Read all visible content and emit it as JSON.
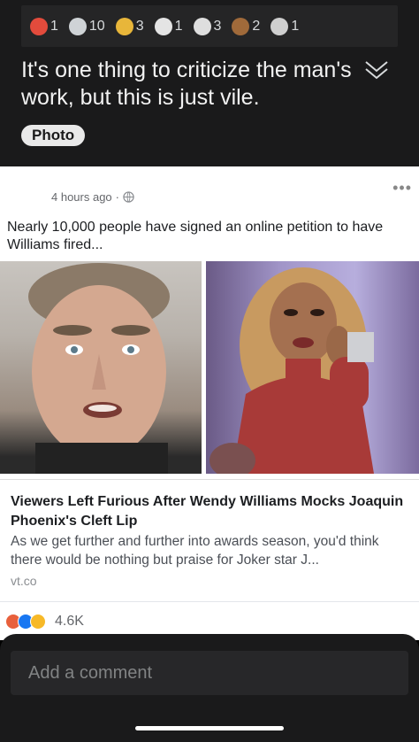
{
  "awards": [
    {
      "icon": "helpful-award-icon",
      "count": "1",
      "color": "#e34b3c"
    },
    {
      "icon": "silver-award-icon",
      "count": "10",
      "color": "#cfd3d6"
    },
    {
      "icon": "gold-award-icon",
      "count": "3",
      "color": "#e8b63a"
    },
    {
      "icon": "facepalm-award-icon",
      "count": "1",
      "color": "#e4e4e4"
    },
    {
      "icon": "hugz-award-icon",
      "count": "3",
      "color": "#dedede"
    },
    {
      "icon": "poop-award-icon",
      "count": "2",
      "color": "#a06a3a"
    },
    {
      "icon": "wholesome-award-icon",
      "count": "1",
      "color": "#cfcfcf"
    }
  ],
  "post": {
    "title": "It's one thing to criticize the man's work, but this is just vile.",
    "flair": "Photo"
  },
  "card": {
    "time": "4 hours ago",
    "separator": "·",
    "caption": "Nearly 10,000 people have signed an online petition to have Williams fired...",
    "link_title": "Viewers Left Furious After Wendy Williams Mocks Joaquin Phoenix's Cleft Lip",
    "link_desc": "As we get further and further into awards season, you'd think there would be nothing but praise for Joker star J...",
    "link_domain": "vt.co",
    "reaction_count": "4.6K"
  },
  "comment": {
    "placeholder": "Add a comment"
  }
}
